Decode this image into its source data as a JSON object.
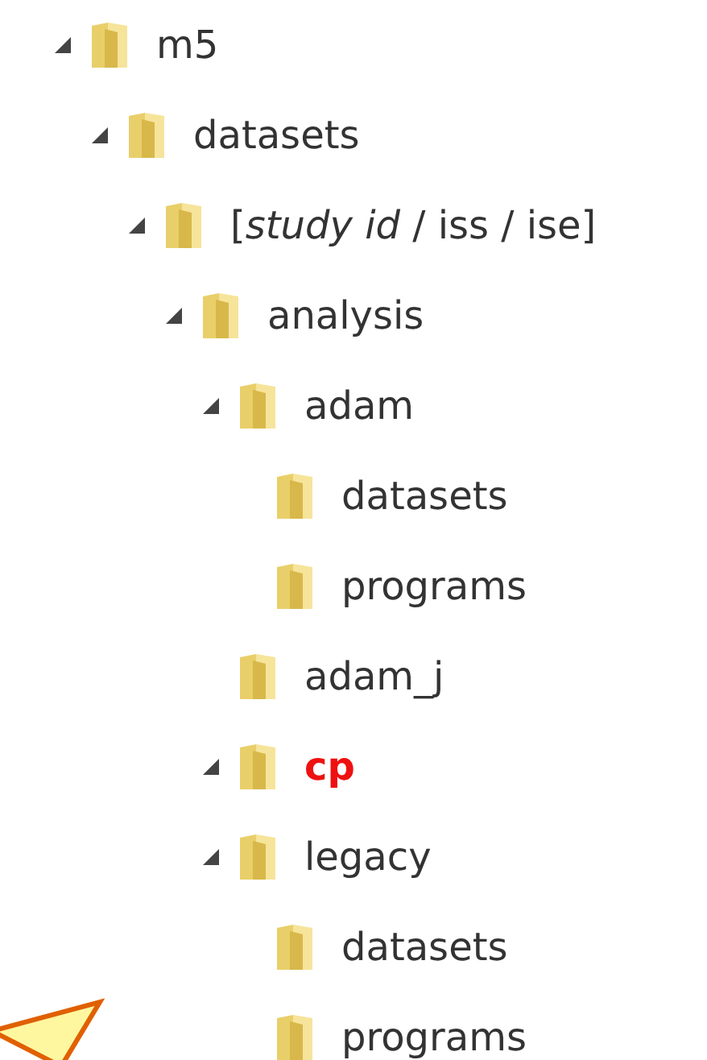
{
  "tree": [
    {
      "label": "m5",
      "expanded": true,
      "highlight": false,
      "children": [
        {
          "label": "datasets",
          "expanded": true,
          "highlight": false,
          "children": [
            {
              "label": "[*study id* / iss / ise]",
              "expanded": true,
              "highlight": false,
              "children": [
                {
                  "label": "analysis",
                  "expanded": true,
                  "highlight": false,
                  "children": [
                    {
                      "label": "adam",
                      "expanded": true,
                      "highlight": false,
                      "children": [
                        {
                          "label": "datasets",
                          "highlight": false
                        },
                        {
                          "label": "programs",
                          "highlight": false
                        }
                      ]
                    },
                    {
                      "label": "adam_j",
                      "highlight": false
                    },
                    {
                      "label": "cp",
                      "expanded": true,
                      "highlight": true
                    },
                    {
                      "label": "legacy",
                      "expanded": true,
                      "highlight": false,
                      "children": [
                        {
                          "label": "datasets",
                          "highlight": false
                        },
                        {
                          "label": "programs",
                          "highlight": false
                        }
                      ]
                    }
                  ]
                }
              ]
            }
          ]
        }
      ]
    }
  ]
}
